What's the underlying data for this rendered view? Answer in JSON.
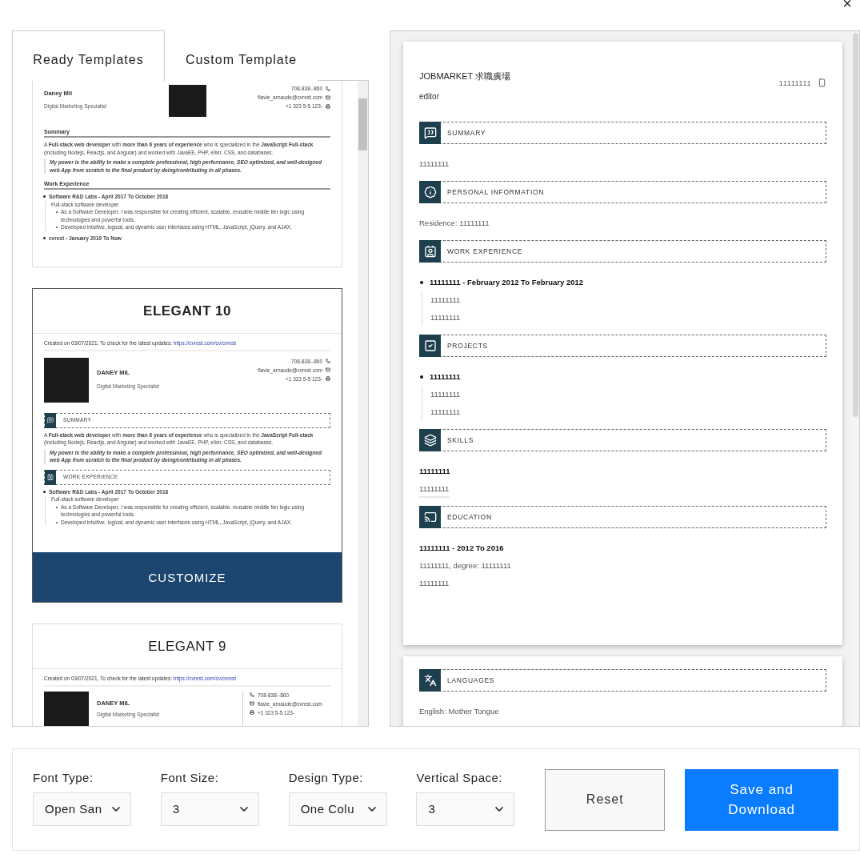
{
  "close_label": "×",
  "tabs": [
    {
      "label": "Ready Templates",
      "selected": true
    },
    {
      "label": "Custom Template",
      "selected": false
    }
  ],
  "templates": [
    {
      "kind": "classic",
      "hovered": false,
      "name": "Daney Mil",
      "role": "Digital Marketing Specialist",
      "contacts": [
        {
          "kind": "phone",
          "text": "708-838--860"
        },
        {
          "kind": "email",
          "text": "flavie_arnaude@cvrest.com"
        },
        {
          "kind": "fax",
          "text": "+1 323 5-5 123-"
        }
      ],
      "sections": [
        {
          "title": "Summary",
          "text": "A **Full-stack web developer** with **more than 6 years of experience** who is specialized in the **JavaScript Full-stack** (including Nodejs, Reactjs, and Angular) and worked with JavaEE, PHP, elixir, CSS, and databases.",
          "quote": "My power is the ability to make a complete professional, high performance, SEO optimized, and well-designed web App from scratch to the final product by doing/contributing in all phases."
        },
        {
          "title": "Work Experience",
          "jobs": [
            {
              "title": "Software R&D Labs - April 2017 To October 2018",
              "role": "Full-stack software developer",
              "bullets": [
                "As a Software Developer, I was responsible for creating efficient, scalable, reusable middle tier logic using technologies and powerful tools.",
                "Developed intuitive, logical, and dynamic user interfaces using HTML, JavaScript, jQuery, and AJAX."
              ]
            },
            {
              "title": "cvrest - January 2019 To Now"
            }
          ]
        }
      ]
    },
    {
      "kind": "elegant",
      "hovered": true,
      "title": "ELEGANT 10",
      "action": "CUSTOMIZE",
      "created": "Created on 03/07/2021, To check for the latest updates:",
      "link": "https://cvrest.com/cv/cvrest",
      "name": "DANEY MIL",
      "role": "Digital Marketing Specialist",
      "contacts": [
        {
          "kind": "phone",
          "text": "708-838--860"
        },
        {
          "kind": "email",
          "text": "flavie_arnaude@cvrest.com"
        },
        {
          "kind": "fax",
          "text": "+1 323 5-5 123-"
        }
      ],
      "sections": [
        {
          "kind": "summary",
          "title": "SUMMARY",
          "text": "A **Full-stack web developer** with **more than 6 years of experience** who is specialized in the **JavaScript Full-stack** (including Nodejs, Reactjs, and Angular) and worked with JavaEE, PHP, elixir, CSS, and databases.",
          "quote": "My power is the ability to make a complete professional, high performance, SEO optimized, and well-designed web App from scratch to the final product by doing/contributing in all phases."
        },
        {
          "kind": "work",
          "title": "WORK EXPERIENCE",
          "jobs": [
            {
              "title": "Software R&D Labs - April 2017 To October 2018",
              "role": "Full-stack software developer",
              "bullets": [
                "As a Software Developer, I was responsible for creating efficient, scalable, reusable middle tier logic using technologies and powerful tools.",
                "Developed intuitive, logical, and dynamic user interfaces using HTML, JavaScript, jQuery, and AJAX."
              ]
            }
          ]
        }
      ]
    },
    {
      "kind": "split",
      "hovered": false,
      "title": "ELEGANT 9",
      "created": "Created on 03/07/2021, To check for the latest updates:",
      "link": "https://cvrest.com/cv/cvrest",
      "name": "DANEY MIL",
      "role": "Digital Marketing Specialist",
      "contacts": [
        {
          "kind": "phone",
          "text": "708-838--860"
        },
        {
          "kind": "email",
          "text": "flavie_arnaude@cvrest.com"
        },
        {
          "kind": "fax",
          "text": "+1 323 5-5 123-"
        }
      ]
    }
  ],
  "preview": {
    "name": "JOBMARKET 求職廣場",
    "role": "editor",
    "contact": "11111111",
    "pages": [
      {
        "sections": [
          {
            "kind": "summary",
            "title": "SUMMARY",
            "lines": [
              "11111111"
            ]
          },
          {
            "kind": "personal",
            "title": "PERSONAL INFORMATION",
            "lines": [
              "Residence: 11111111"
            ]
          },
          {
            "kind": "work",
            "title": "WORK EXPERIENCE",
            "heading": "11111111 - February 2012 To February 2012",
            "lines": [
              "11111111",
              "11111111"
            ]
          },
          {
            "kind": "projects",
            "title": "PROJECTS",
            "heading": "11111111",
            "lines": [
              "11111111",
              "11111111"
            ]
          },
          {
            "kind": "skills",
            "title": "SKILLS",
            "heading": "11111111",
            "lines": [
              "11111111"
            ]
          },
          {
            "kind": "education",
            "title": "EDUCATION",
            "heading": "11111111 - 2012 To 2016",
            "lines": [
              "11111111, degree: 11111111",
              "11111111"
            ]
          }
        ]
      },
      {
        "sections": [
          {
            "kind": "languages",
            "title": "LANGUAGES",
            "lines": [
              "English: Mother Tongue"
            ]
          }
        ]
      }
    ]
  },
  "settings": [
    {
      "label": "Font Type:",
      "value": "Open San"
    },
    {
      "label": "Font Size:",
      "value": "3"
    },
    {
      "label": "Design Type:",
      "value": "One Colu"
    },
    {
      "label": "Vertical Space:",
      "value": "3"
    }
  ],
  "reset": "Reset",
  "save": "Save and Download"
}
